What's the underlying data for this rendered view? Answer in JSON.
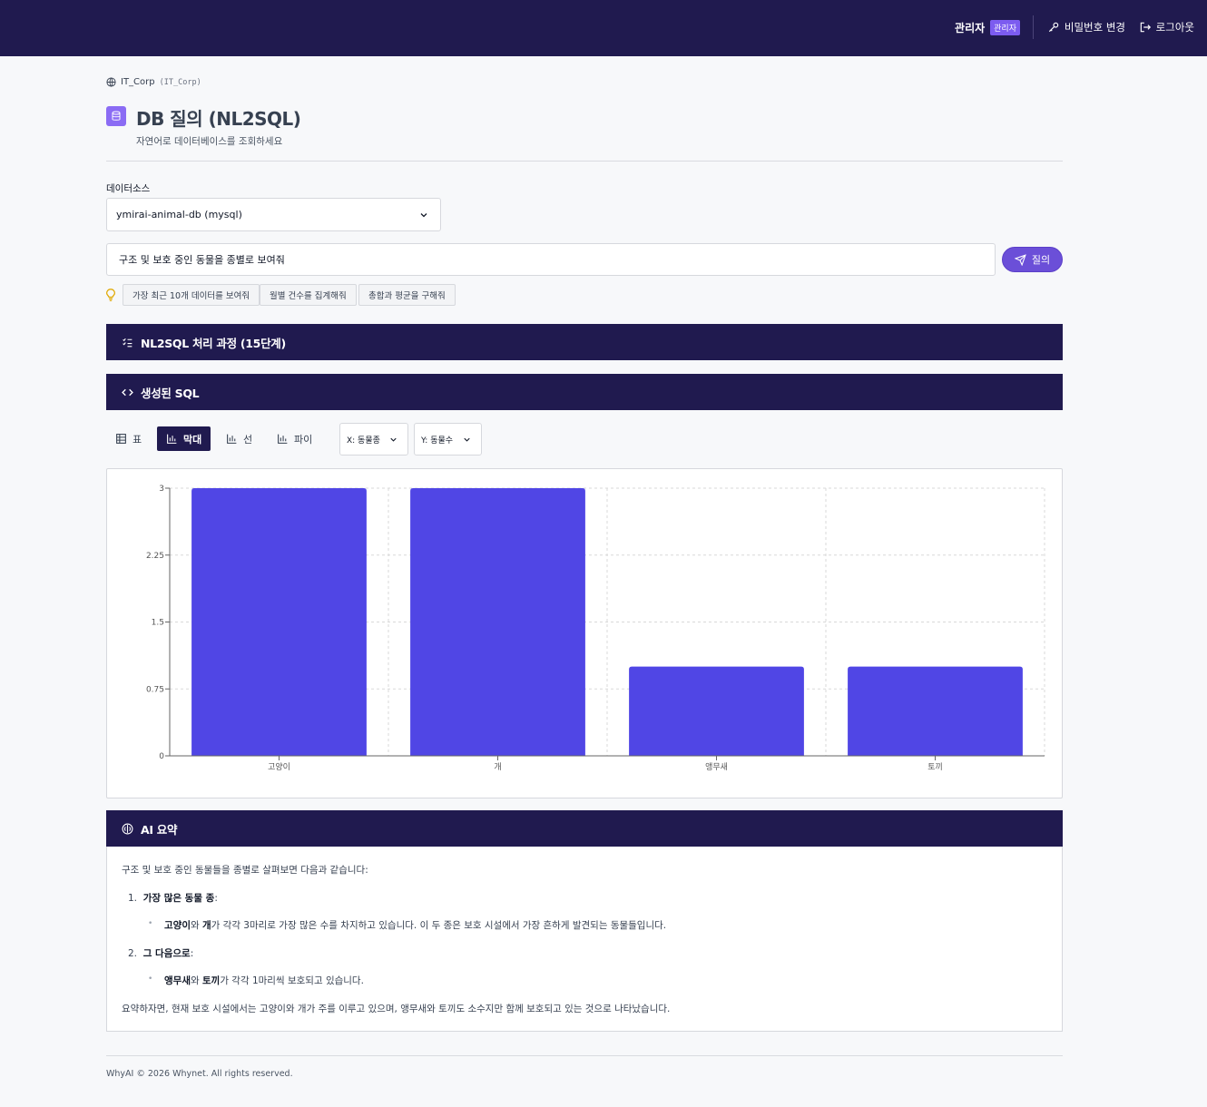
{
  "header": {
    "username": "관리자",
    "role_badge": "관리자",
    "change_password": "비밀번호 변경",
    "logout": "로그아웃"
  },
  "breadcrumb": {
    "org_name": "IT_Corp",
    "org_code": "(IT_Corp)"
  },
  "page": {
    "title": "DB 질의 (NL2SQL)",
    "subtitle": "자연어로 데이터베이스를 조회하세요"
  },
  "datasource": {
    "label": "데이터소스",
    "selected": "ymirai-animal-db (mysql)"
  },
  "query": {
    "value": "구조 및 보호 중인 동물을 종별로 보여줘",
    "submit_label": "질의"
  },
  "suggestions": [
    "가장 최근 10개 데이터를 보여줘",
    "월별 건수를 집계해줘",
    "총합과 평균을 구해줘"
  ],
  "panels": {
    "process": "NL2SQL 처리 과정 (15단계)",
    "sql": "생성된 SQL",
    "summary": "AI 요약"
  },
  "view_tabs": {
    "table": "표",
    "bar": "막대",
    "line": "선",
    "pie": "파이",
    "active": "bar"
  },
  "axis_select": {
    "x": "X: 동물종",
    "y": "Y: 동물수"
  },
  "chart_data": {
    "type": "bar",
    "categories": [
      "고양이",
      "개",
      "앵무새",
      "토끼"
    ],
    "values": [
      3,
      3,
      1,
      1
    ],
    "ylim": [
      0,
      3
    ],
    "yticks": [
      "0",
      "0.75",
      "1.5",
      "2.25",
      "3"
    ],
    "xlabel": "",
    "ylabel": "",
    "grid": true,
    "color": "#5046e5"
  },
  "summary": {
    "intro": "구조 및 보호 중인 동물들을 종별로 살펴보면 다음과 같습니다:",
    "item1_num": "1.",
    "item1_head": "가장 많은 동물 종",
    "item1_colon": ":",
    "item1_a": "고양이",
    "item1_and": "와 ",
    "item1_b": "개",
    "item1_rest": "가 각각 3마리로 가장 많은 수를 차지하고 있습니다. 이 두 종은 보호 시설에서 가장 흔하게 발견되는 동물들입니다.",
    "item2_num": "2.",
    "item2_head": "그 다음으로",
    "item2_colon": ":",
    "item2_a": "앵무새",
    "item2_and": "와 ",
    "item2_b": "토끼",
    "item2_rest": "가 각각 1마리씩 보호되고 있습니다.",
    "conclusion": "요약하자면, 현재 보호 시설에서는 고양이와 개가 주를 이루고 있으며, 앵무새와 토끼도 소수지만 함께 보호되고 있는 것으로 나타났습니다."
  },
  "footer": "WhyAI © 2026 Whynet. All rights reserved."
}
